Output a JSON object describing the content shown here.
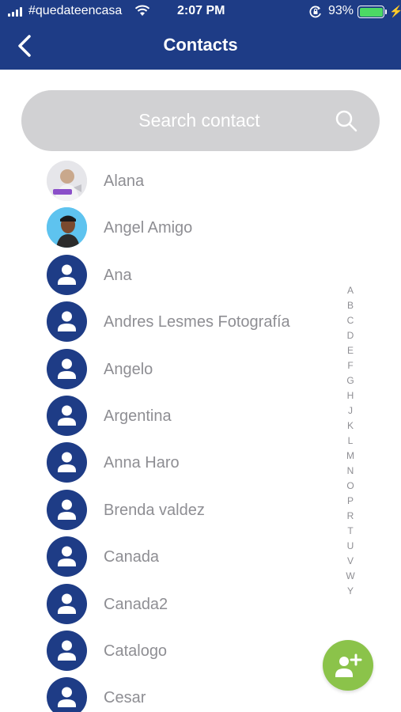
{
  "status_bar": {
    "carrier": "#quedateencasa",
    "time": "2:07 PM",
    "battery": "93%"
  },
  "header": {
    "title": "Contacts"
  },
  "search": {
    "placeholder": "Search contact"
  },
  "contacts": [
    {
      "name": "Alana",
      "avatar": "photo-1"
    },
    {
      "name": "Angel Amigo",
      "avatar": "photo-2"
    },
    {
      "name": "Ana",
      "avatar": "person-icon"
    },
    {
      "name": "Andres Lesmes Fotografía",
      "avatar": "person-icon"
    },
    {
      "name": "Angelo",
      "avatar": "person-icon"
    },
    {
      "name": "Argentina",
      "avatar": "person-icon"
    },
    {
      "name": "Anna Haro",
      "avatar": "person-icon"
    },
    {
      "name": "Brenda valdez",
      "avatar": "person-icon"
    },
    {
      "name": "Canada",
      "avatar": "person-icon"
    },
    {
      "name": "Canada2",
      "avatar": "person-icon"
    },
    {
      "name": "Catalogo",
      "avatar": "person-icon"
    },
    {
      "name": "Cesar",
      "avatar": "person-icon"
    }
  ],
  "alpha_index": [
    "A",
    "B",
    "C",
    "D",
    "E",
    "F",
    "G",
    "H",
    "J",
    "K",
    "L",
    "M",
    "N",
    "O",
    "P",
    "R",
    "T",
    "U",
    "V",
    "W",
    "Y"
  ],
  "colors": {
    "header": "#1e3c86",
    "fab": "#8bc34a",
    "search_bg": "#d1d1d3",
    "name_text": "#8e8e93"
  }
}
